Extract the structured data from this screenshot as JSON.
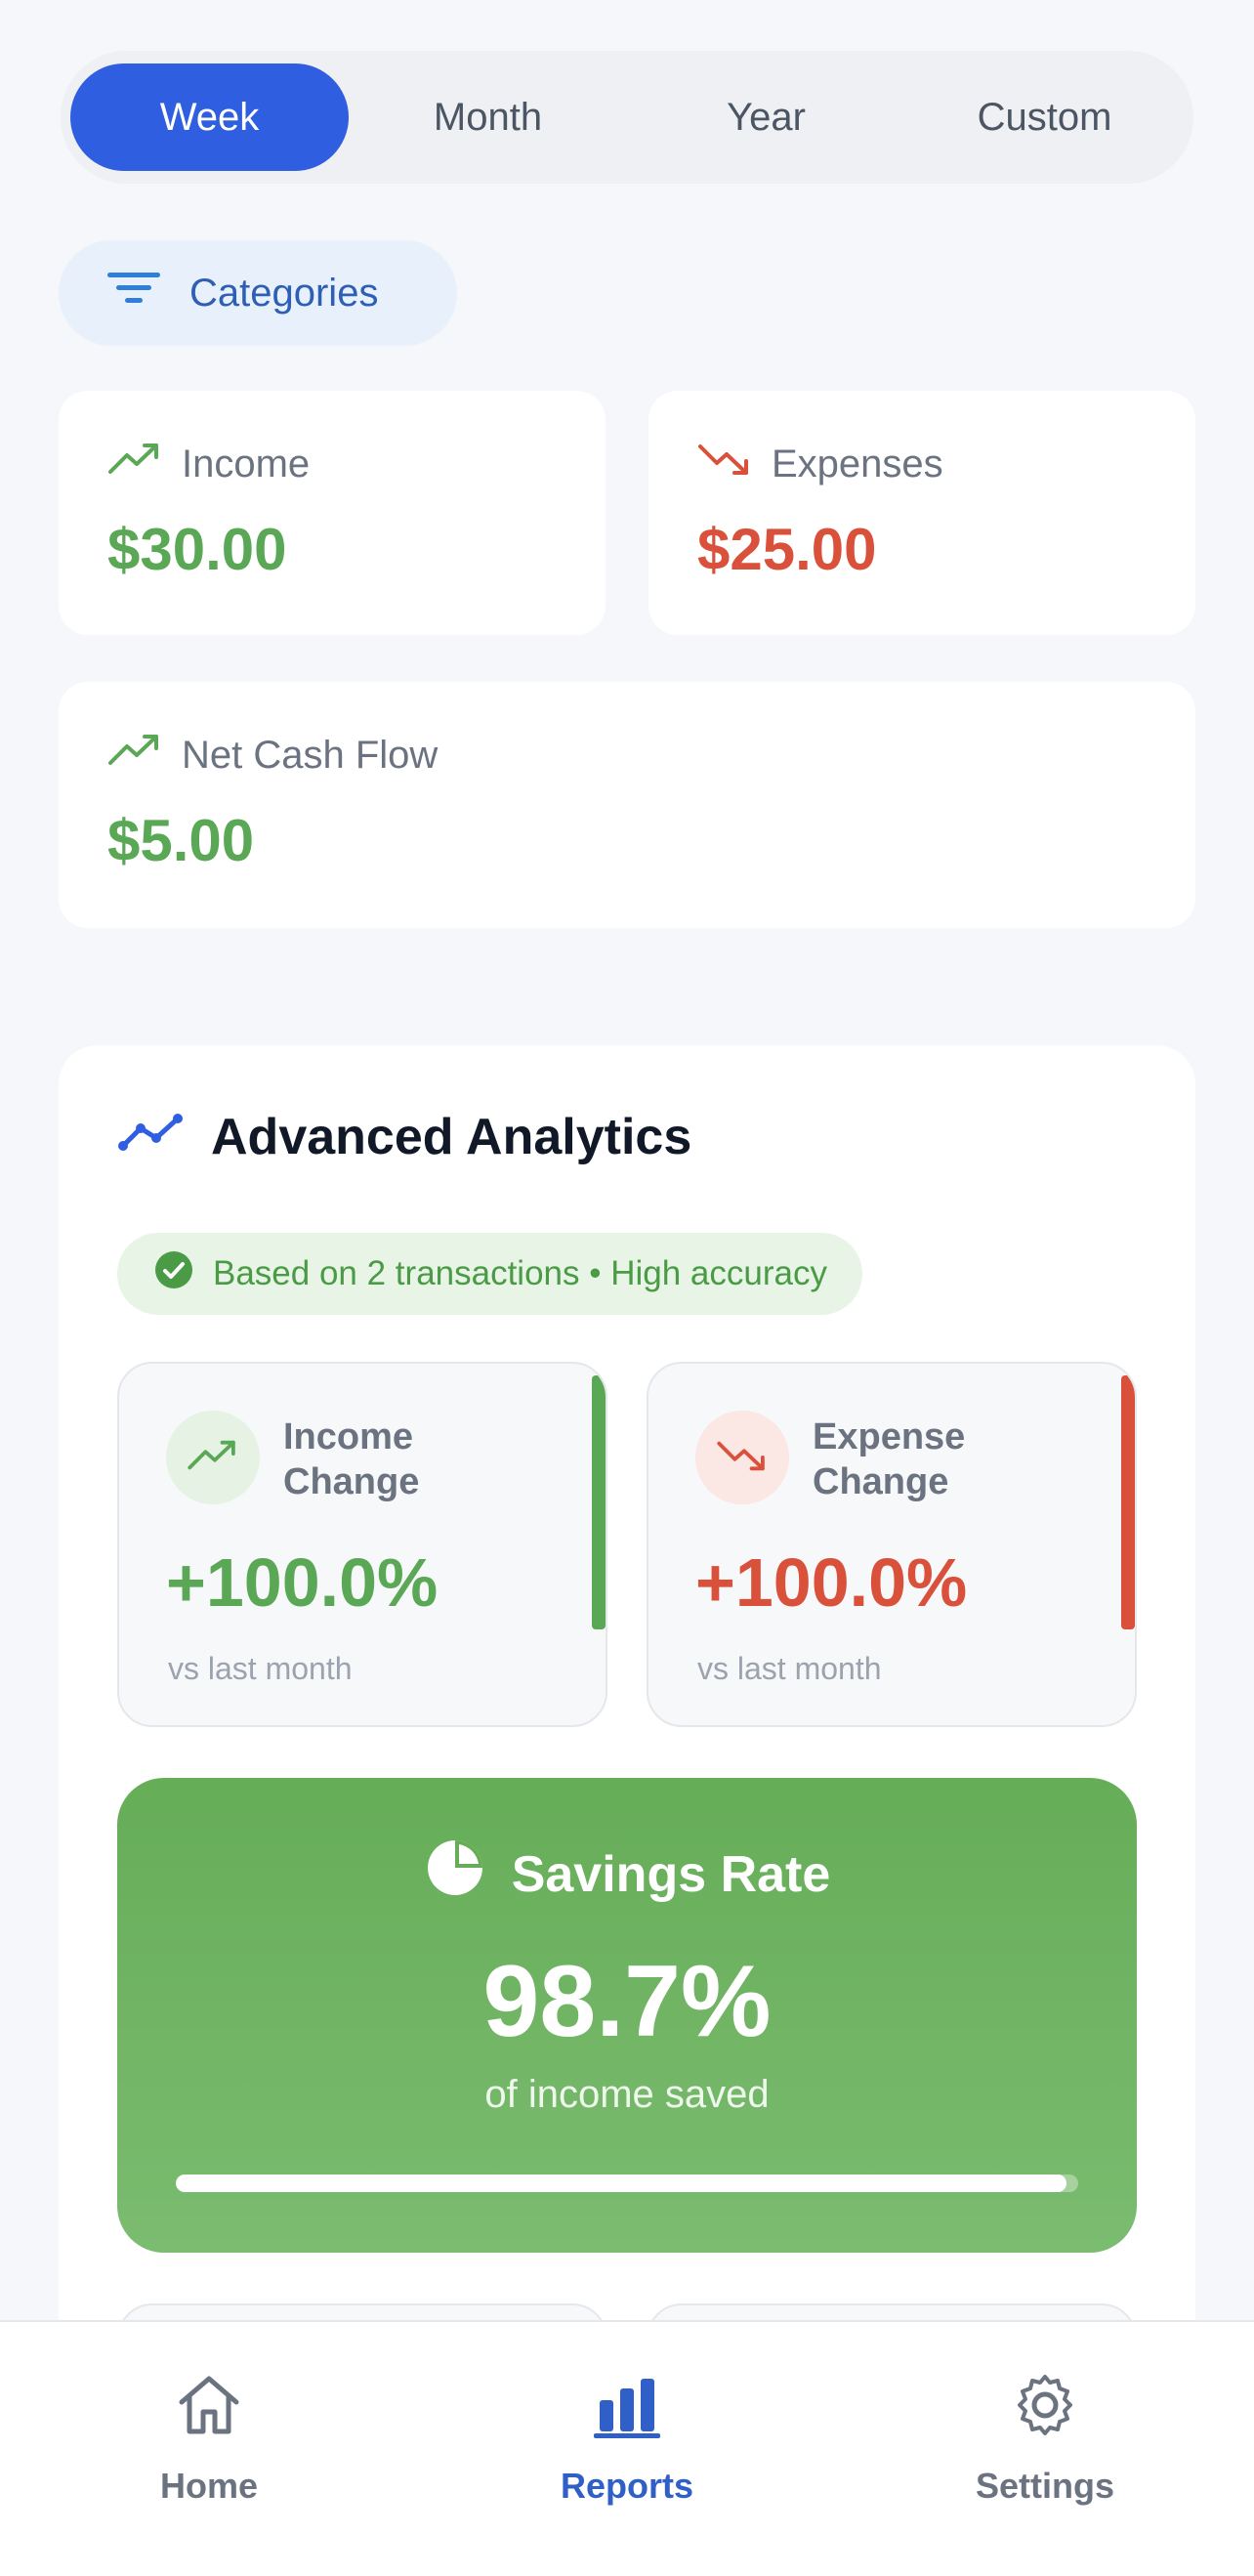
{
  "period_tabs": [
    {
      "label": "Week",
      "active": true
    },
    {
      "label": "Month",
      "active": false
    },
    {
      "label": "Year",
      "active": false
    },
    {
      "label": "Custom",
      "active": false
    }
  ],
  "filter": {
    "label": "Categories",
    "icon": "filter-icon"
  },
  "summary": {
    "income": {
      "label": "Income",
      "value": "$30.00",
      "icon": "trending-up-icon"
    },
    "expenses": {
      "label": "Expenses",
      "value": "$25.00",
      "icon": "trending-down-icon"
    },
    "net": {
      "label": "Net Cash Flow",
      "value": "$5.00",
      "icon": "trending-up-icon"
    }
  },
  "analytics": {
    "title": "Advanced Analytics",
    "accuracy": "Based on 2 transactions • High accuracy",
    "income_change": {
      "label_line1": "Income",
      "label_line2": "Change",
      "value": "+100.0%",
      "sub": "vs last month"
    },
    "expense_change": {
      "label_line1": "Expense",
      "label_line2": "Change",
      "value": "+100.0%",
      "sub": "vs last month"
    },
    "savings": {
      "title": "Savings Rate",
      "value": "98.7%",
      "sub": "of income saved",
      "progress": 0.987
    }
  },
  "colors": {
    "accent": "#2f5fe0",
    "positive": "#5aa855",
    "negative": "#d9503b",
    "savings_bg": "#6bb05d"
  },
  "nav": [
    {
      "label": "Home",
      "icon": "home-icon",
      "active": false
    },
    {
      "label": "Reports",
      "icon": "bar-chart-icon",
      "active": true
    },
    {
      "label": "Settings",
      "icon": "gear-icon",
      "active": false
    }
  ]
}
